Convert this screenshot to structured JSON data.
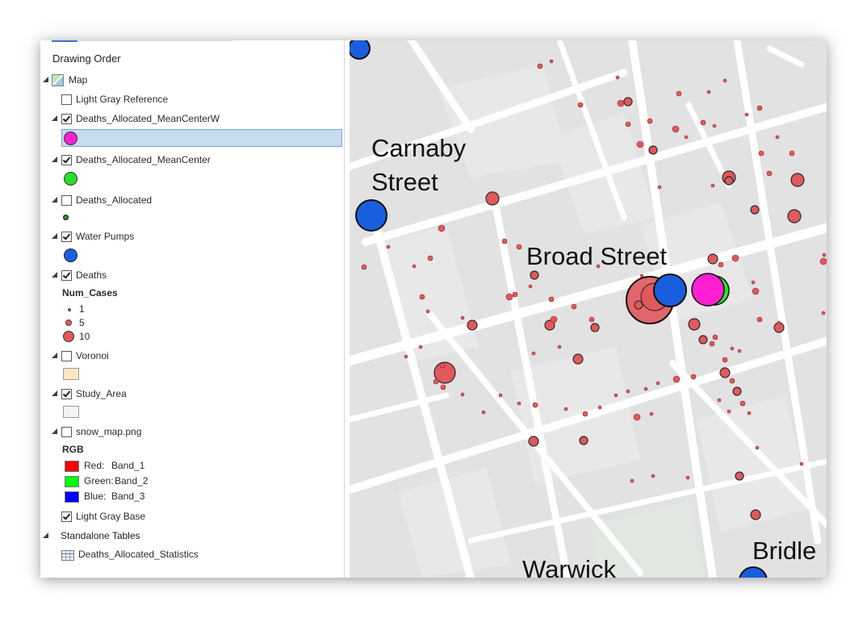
{
  "contents": {
    "heading": "Drawing Order",
    "map_label": "Map",
    "layers": {
      "light_gray_reference": {
        "label": "Light Gray Reference",
        "checked": false
      },
      "mean_center_w": {
        "label": "Deaths_Allocated_MeanCenterW",
        "checked": true,
        "symbol_color": "#ff1fd2",
        "selected": true
      },
      "mean_center": {
        "label": "Deaths_Allocated_MeanCenter",
        "checked": true,
        "symbol_color": "#27e02b"
      },
      "deaths_allocated": {
        "label": "Deaths_Allocated",
        "checked": false,
        "symbol_color": "#2e8b2e"
      },
      "water_pumps": {
        "label": "Water Pumps",
        "checked": true,
        "symbol_color": "#1a5ee0"
      },
      "deaths": {
        "label": "Deaths",
        "checked": true,
        "field": "Num_Cases",
        "classes": [
          {
            "label": "1",
            "color": "#e0595c"
          },
          {
            "label": "5",
            "color": "#e0595c"
          },
          {
            "label": "10",
            "color": "#e0595c"
          }
        ]
      },
      "voronoi": {
        "label": "Voronoi",
        "checked": false,
        "fill_color": "#fde7c3"
      },
      "study_area": {
        "label": "Study_Area",
        "checked": true,
        "fill_color": "#f4f4f4"
      },
      "snow_map": {
        "label": "snow_map.png",
        "checked": false,
        "group": "RGB",
        "bands": [
          {
            "channel": "Red:",
            "band": "Band_1",
            "color": "#ff0000"
          },
          {
            "channel": "Green:",
            "band": "Band_2",
            "color": "#00ff00"
          },
          {
            "channel": "Blue:",
            "band": "Band_3",
            "color": "#0000ff"
          }
        ]
      },
      "light_gray_base": {
        "label": "Light Gray Base",
        "checked": true
      }
    },
    "standalone_tables": {
      "label": "Standalone Tables",
      "items": [
        {
          "label": "Deaths_Allocated_Statistics"
        }
      ]
    }
  },
  "map": {
    "street_labels": {
      "carnaby_1": "Carnaby",
      "carnaby_2": "Street",
      "broad": "Broad Street",
      "warwick": "Warwick",
      "bridle": "Bridle"
    },
    "colors": {
      "background": "#e2e2e2",
      "street": "#ffffff",
      "death_fill": "#e0595c",
      "pump_fill": "#1a5ee0",
      "mean_center_w": "#ff1fd2",
      "mean_center": "#27e02b",
      "park": "#e1e7e1"
    }
  }
}
